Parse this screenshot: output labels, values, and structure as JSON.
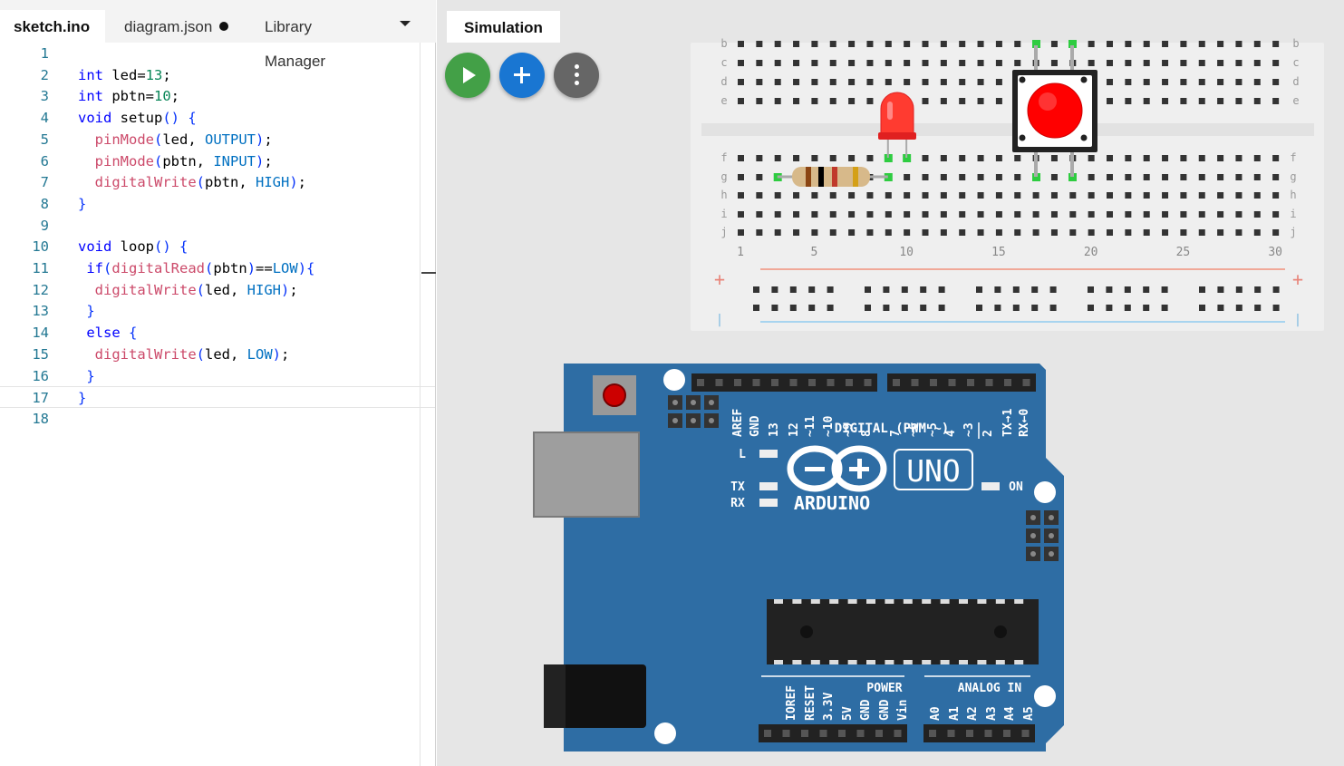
{
  "editor": {
    "tabs": [
      {
        "label": "sketch.ino"
      },
      {
        "label": "diagram.json"
      },
      {
        "label": "Library Manager"
      }
    ],
    "lines": [
      {
        "n": "1"
      },
      {
        "n": "2"
      },
      {
        "n": "3"
      },
      {
        "n": "4"
      },
      {
        "n": "5"
      },
      {
        "n": "6"
      },
      {
        "n": "7"
      },
      {
        "n": "8"
      },
      {
        "n": "9"
      },
      {
        "n": "10"
      },
      {
        "n": "11"
      },
      {
        "n": "12"
      },
      {
        "n": "13"
      },
      {
        "n": "14"
      },
      {
        "n": "15"
      },
      {
        "n": "16"
      },
      {
        "n": "17"
      },
      {
        "n": "18"
      }
    ],
    "code": [
      "",
      "int led=13;",
      "int pbtn=10;",
      "void setup() {",
      "  pinMode(led, OUTPUT);",
      "  pinMode(pbtn, INPUT);",
      "  digitalWrite(pbtn, HIGH);",
      "}",
      "",
      "void loop() {",
      " if(digitalRead(pbtn)==LOW){",
      "  digitalWrite(led, HIGH);",
      " }",
      " else {",
      "  digitalWrite(led, LOW);",
      " }",
      "}",
      ""
    ]
  },
  "simulation": {
    "tab_label": "Simulation",
    "breadboard": {
      "row_labels": [
        "b",
        "c",
        "d",
        "e",
        "f",
        "g",
        "h",
        "i",
        "j"
      ],
      "col_numbers": [
        "1",
        "5",
        "10",
        "15",
        "20",
        "25",
        "30"
      ],
      "rail_plus": "+",
      "rail_minus": "|"
    },
    "arduino": {
      "header_top_labels": [
        "AREF",
        "GND",
        "13",
        "12",
        "~11",
        "~10",
        "~9",
        "8",
        "7",
        "~6",
        "~5",
        "4",
        "~3",
        "2",
        "TX→1",
        "RX←0"
      ],
      "digital_label": "DIGITAL (PWM ~)",
      "led_l": "L",
      "led_tx": "TX",
      "led_rx": "RX",
      "on_label": "ON",
      "logo_text": "ARDUINO",
      "model": "UNO",
      "power_label": "POWER",
      "analog_label": "ANALOG IN",
      "power_pins": [
        "IOREF",
        "RESET",
        "3.3V",
        "5V",
        "GND",
        "GND",
        "Vin"
      ],
      "analog_pins": [
        "A0",
        "A1",
        "A2",
        "A3",
        "A4",
        "A5"
      ]
    },
    "colors": {
      "board_blue": "#2e6da4",
      "led_red": "#ff3b30",
      "button_red": "#ff0000",
      "run_green": "#43a047",
      "add_blue": "#1976d2"
    }
  }
}
